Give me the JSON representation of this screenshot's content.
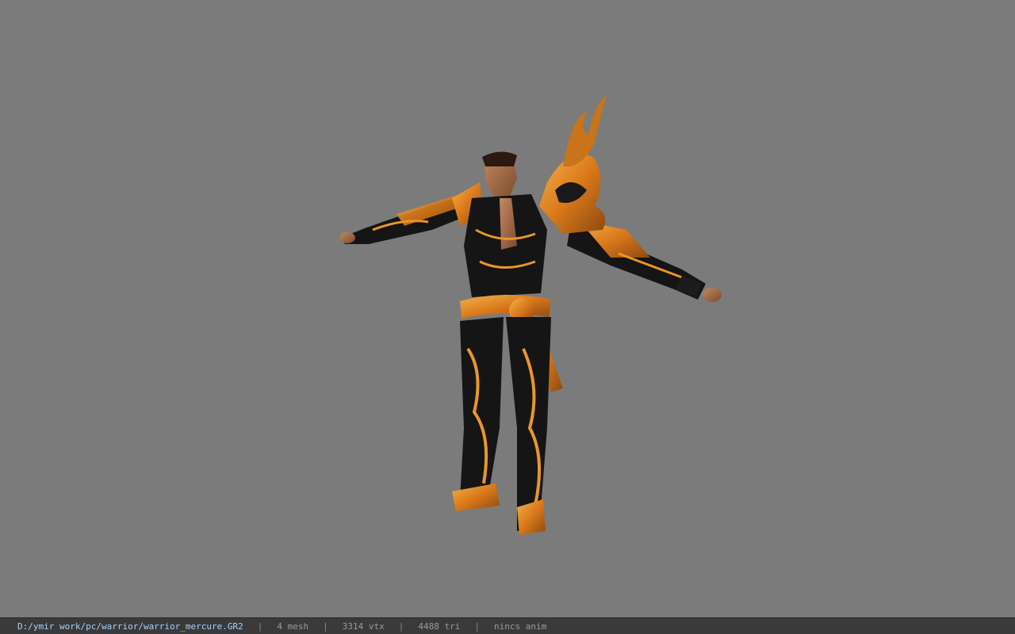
{
  "viewer": {
    "background_color": "#7b7b7b",
    "model_name": "warrior_mercure"
  },
  "status": {
    "file_path": "D:/ymir work/pc/warrior/warrior_mercure.GR2",
    "separator": "|",
    "mesh": "4 mesh",
    "vertices": "3314 vtx",
    "triangles": "4488 tri",
    "animation": "nincs anim"
  },
  "colors": {
    "armor_black": "#141414",
    "armor_gold": "#e08a1e",
    "skin": "#a86a45",
    "path_text": "#9fd3ff"
  }
}
